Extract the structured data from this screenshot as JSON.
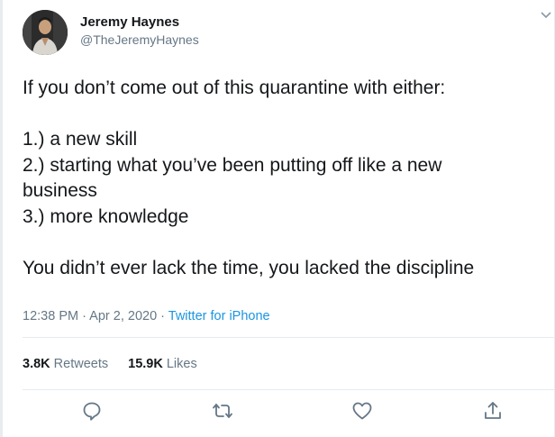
{
  "author": {
    "display_name": "Jeremy Haynes",
    "handle": "@TheJeremyHaynes"
  },
  "tweet": {
    "paragraphs": [
      [
        "If you don’t come out of this quarantine with either:"
      ],
      [
        "1.) a new skill",
        "2.) starting what you’ve been putting off like a new",
        "business",
        "3.) more knowledge"
      ],
      [
        "You didn’t ever lack the time, you lacked the discipline"
      ]
    ]
  },
  "meta": {
    "time": "12:38 PM",
    "sep1": " · ",
    "date": "Apr 2, 2020",
    "sep2": " · ",
    "source": "Twitter for iPhone"
  },
  "stats": {
    "retweets_count": "3.8K",
    "retweets_label": "Retweets",
    "likes_count": "15.9K",
    "likes_label": "Likes"
  },
  "icons": {
    "reply": "reply-icon",
    "retweet": "retweet-icon",
    "like": "heart-icon",
    "share": "share-icon",
    "menu": "chevron-down-icon"
  },
  "colors": {
    "text": "#14171a",
    "secondary": "#657786",
    "link": "#1b95e0",
    "border": "#e6ecf0"
  }
}
